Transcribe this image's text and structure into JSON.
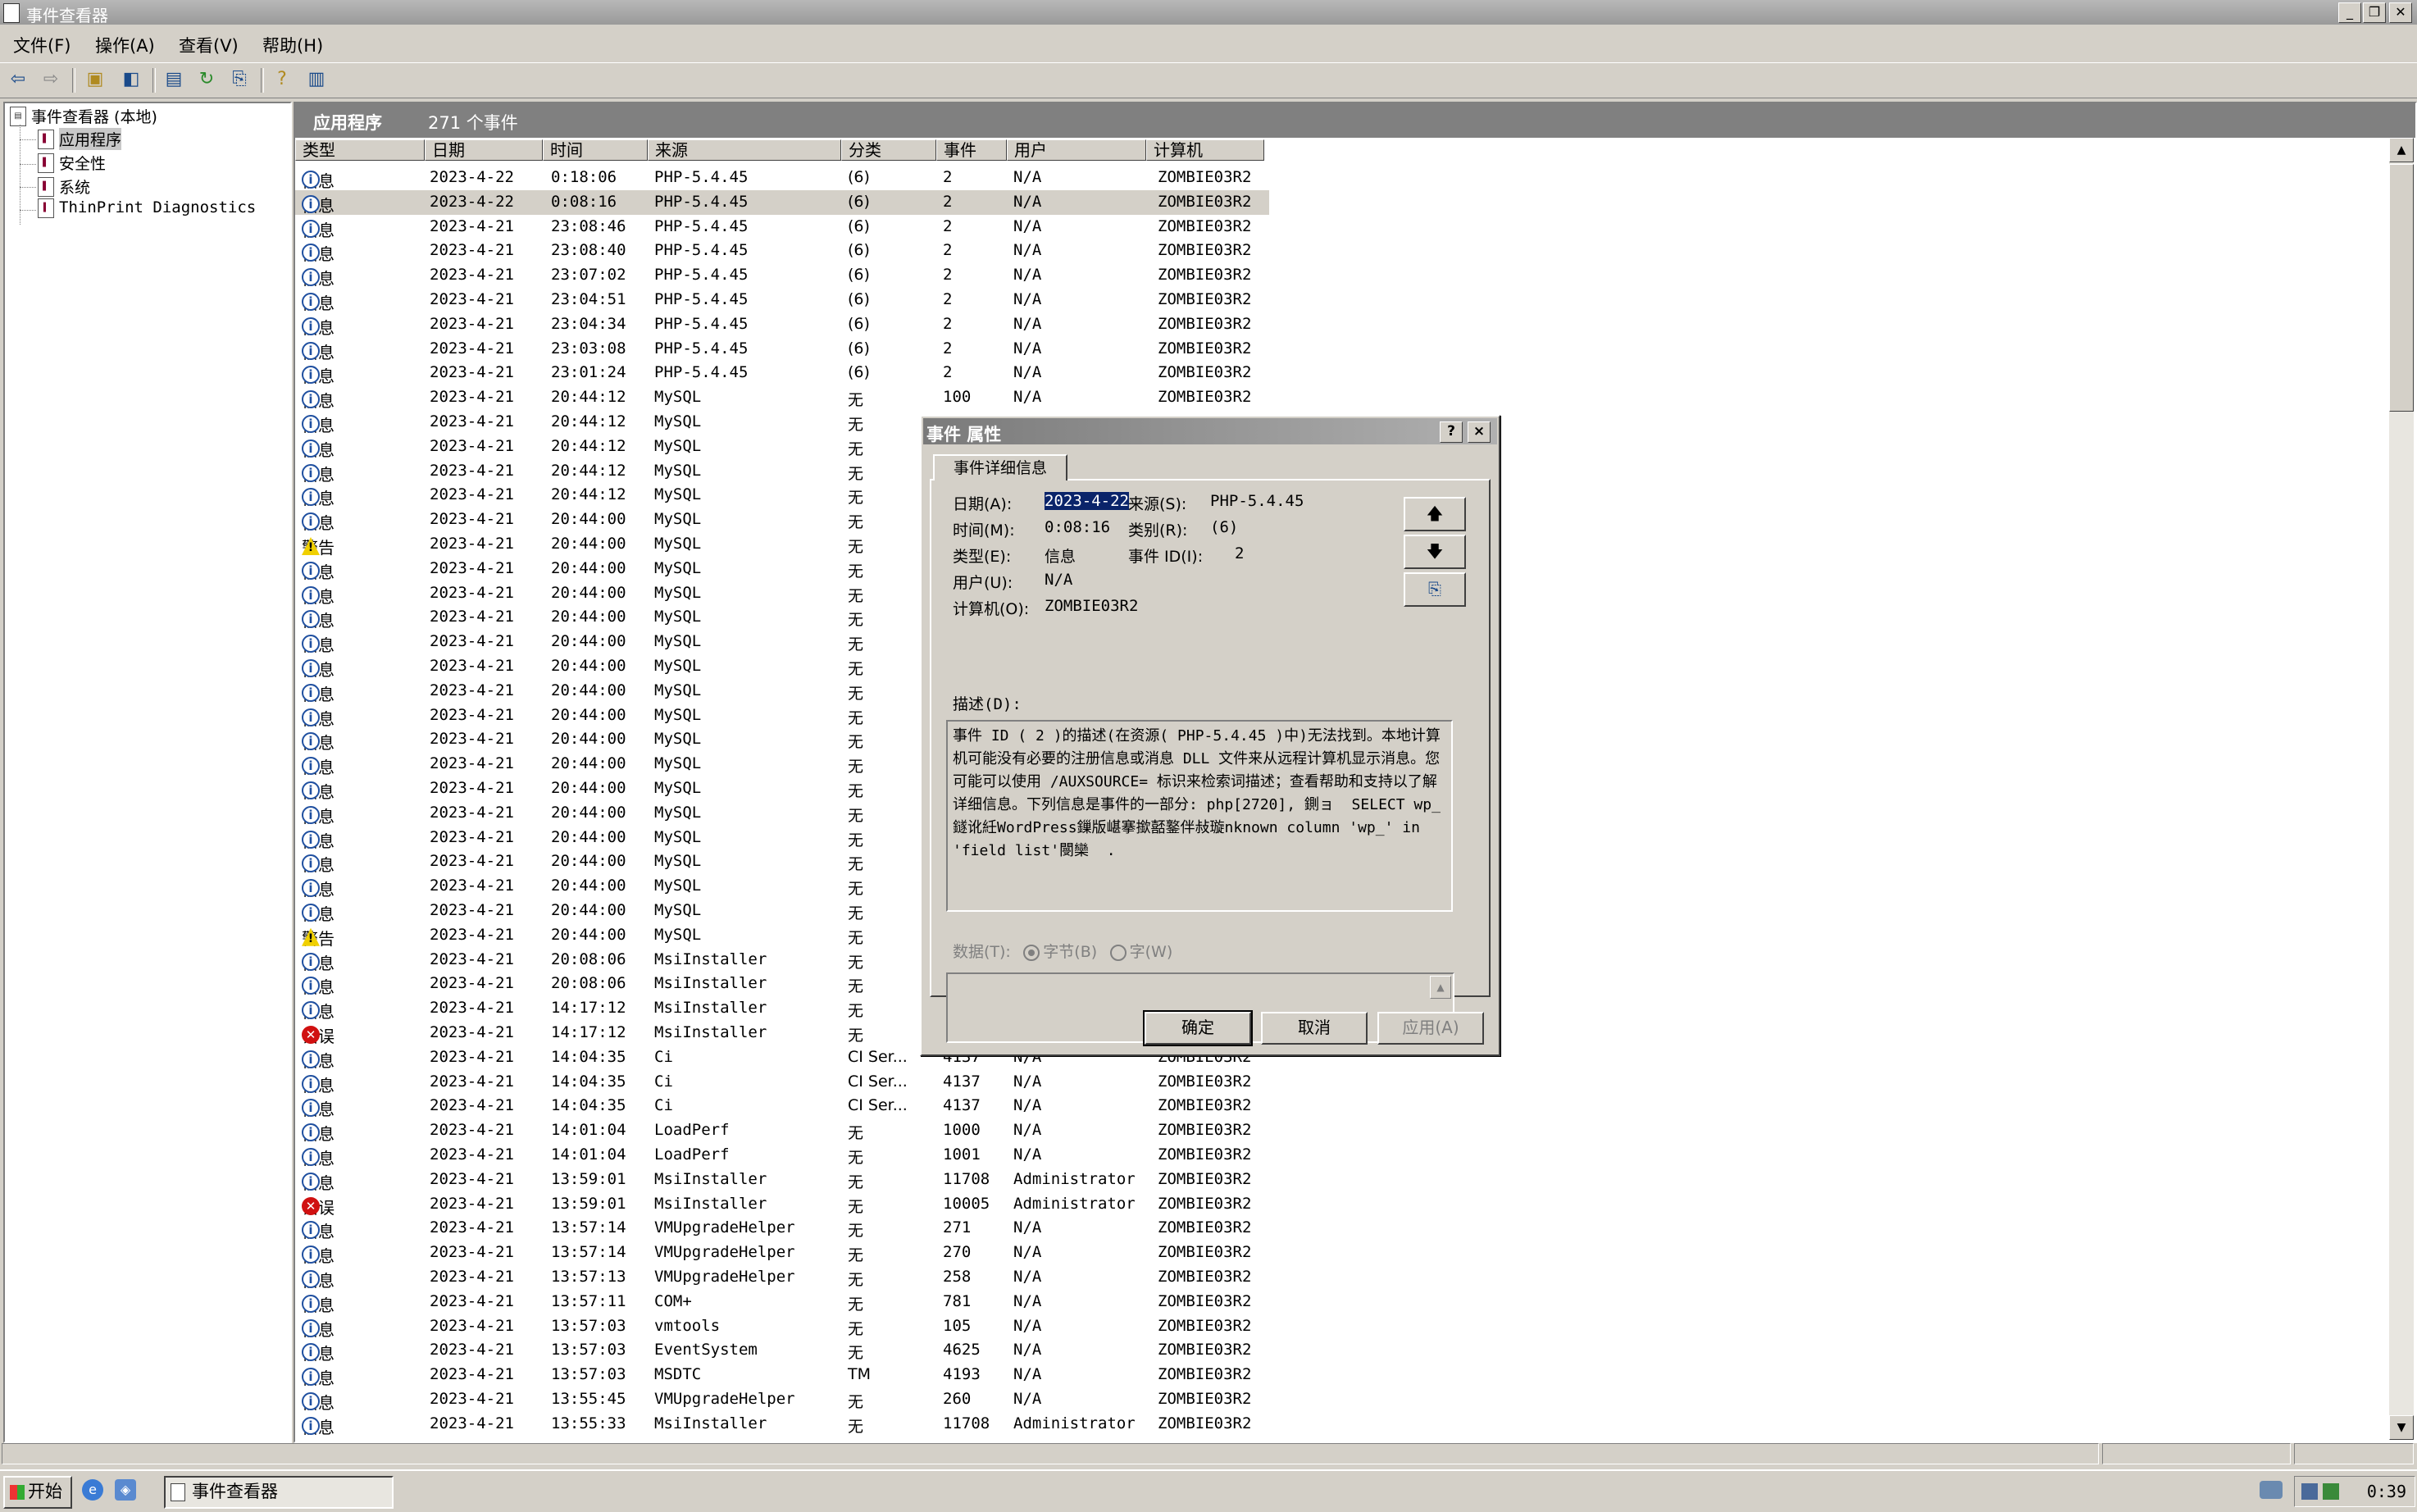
{
  "window": {
    "title": "事件查看器"
  },
  "menu": [
    "文件(F)",
    "操作(A)",
    "查看(V)",
    "帮助(H)"
  ],
  "tree": {
    "root": "事件查看器 (本地)",
    "items": [
      {
        "label": "应用程序",
        "selected": true
      },
      {
        "label": "安全性"
      },
      {
        "label": "系统"
      },
      {
        "label": "ThinPrint Diagnostics"
      }
    ]
  },
  "pane": {
    "title": "应用程序",
    "count": "271 个事件"
  },
  "columns": [
    "类型",
    "日期",
    "时间",
    "来源",
    "分类",
    "事件",
    "用户",
    "计算机"
  ],
  "rows": [
    {
      "type": "info",
      "tn": "信息",
      "d": "2023-4-22",
      "t": "0:18:06",
      "src": "PHP-5.4.45",
      "cat": "(6)",
      "ev": "2",
      "u": "N/A",
      "c": "ZOMBIE03R2"
    },
    {
      "type": "info",
      "tn": "信息",
      "d": "2023-4-22",
      "t": "0:08:16",
      "src": "PHP-5.4.45",
      "cat": "(6)",
      "ev": "2",
      "u": "N/A",
      "c": "ZOMBIE03R2",
      "sel": true
    },
    {
      "type": "info",
      "tn": "信息",
      "d": "2023-4-21",
      "t": "23:08:46",
      "src": "PHP-5.4.45",
      "cat": "(6)",
      "ev": "2",
      "u": "N/A",
      "c": "ZOMBIE03R2"
    },
    {
      "type": "info",
      "tn": "信息",
      "d": "2023-4-21",
      "t": "23:08:40",
      "src": "PHP-5.4.45",
      "cat": "(6)",
      "ev": "2",
      "u": "N/A",
      "c": "ZOMBIE03R2"
    },
    {
      "type": "info",
      "tn": "信息",
      "d": "2023-4-21",
      "t": "23:07:02",
      "src": "PHP-5.4.45",
      "cat": "(6)",
      "ev": "2",
      "u": "N/A",
      "c": "ZOMBIE03R2"
    },
    {
      "type": "info",
      "tn": "信息",
      "d": "2023-4-21",
      "t": "23:04:51",
      "src": "PHP-5.4.45",
      "cat": "(6)",
      "ev": "2",
      "u": "N/A",
      "c": "ZOMBIE03R2"
    },
    {
      "type": "info",
      "tn": "信息",
      "d": "2023-4-21",
      "t": "23:04:34",
      "src": "PHP-5.4.45",
      "cat": "(6)",
      "ev": "2",
      "u": "N/A",
      "c": "ZOMBIE03R2"
    },
    {
      "type": "info",
      "tn": "信息",
      "d": "2023-4-21",
      "t": "23:03:08",
      "src": "PHP-5.4.45",
      "cat": "(6)",
      "ev": "2",
      "u": "N/A",
      "c": "ZOMBIE03R2"
    },
    {
      "type": "info",
      "tn": "信息",
      "d": "2023-4-21",
      "t": "23:01:24",
      "src": "PHP-5.4.45",
      "cat": "(6)",
      "ev": "2",
      "u": "N/A",
      "c": "ZOMBIE03R2"
    },
    {
      "type": "info",
      "tn": "信息",
      "d": "2023-4-21",
      "t": "20:44:12",
      "src": "MySQL",
      "cat": "无",
      "ev": "100",
      "u": "N/A",
      "c": "ZOMBIE03R2"
    },
    {
      "type": "info",
      "tn": "信息",
      "d": "2023-4-21",
      "t": "20:44:12",
      "src": "MySQL",
      "cat": "无",
      "ev": "",
      "u": "",
      "c": ""
    },
    {
      "type": "info",
      "tn": "信息",
      "d": "2023-4-21",
      "t": "20:44:12",
      "src": "MySQL",
      "cat": "无",
      "ev": "",
      "u": "",
      "c": ""
    },
    {
      "type": "info",
      "tn": "信息",
      "d": "2023-4-21",
      "t": "20:44:12",
      "src": "MySQL",
      "cat": "无",
      "ev": "",
      "u": "",
      "c": ""
    },
    {
      "type": "info",
      "tn": "信息",
      "d": "2023-4-21",
      "t": "20:44:12",
      "src": "MySQL",
      "cat": "无",
      "ev": "",
      "u": "",
      "c": ""
    },
    {
      "type": "info",
      "tn": "信息",
      "d": "2023-4-21",
      "t": "20:44:00",
      "src": "MySQL",
      "cat": "无",
      "ev": "",
      "u": "",
      "c": ""
    },
    {
      "type": "warn",
      "tn": "警告",
      "d": "2023-4-21",
      "t": "20:44:00",
      "src": "MySQL",
      "cat": "无",
      "ev": "",
      "u": "",
      "c": ""
    },
    {
      "type": "info",
      "tn": "信息",
      "d": "2023-4-21",
      "t": "20:44:00",
      "src": "MySQL",
      "cat": "无",
      "ev": "",
      "u": "",
      "c": ""
    },
    {
      "type": "info",
      "tn": "信息",
      "d": "2023-4-21",
      "t": "20:44:00",
      "src": "MySQL",
      "cat": "无",
      "ev": "",
      "u": "",
      "c": ""
    },
    {
      "type": "info",
      "tn": "信息",
      "d": "2023-4-21",
      "t": "20:44:00",
      "src": "MySQL",
      "cat": "无",
      "ev": "",
      "u": "",
      "c": ""
    },
    {
      "type": "info",
      "tn": "信息",
      "d": "2023-4-21",
      "t": "20:44:00",
      "src": "MySQL",
      "cat": "无",
      "ev": "",
      "u": "",
      "c": ""
    },
    {
      "type": "info",
      "tn": "信息",
      "d": "2023-4-21",
      "t": "20:44:00",
      "src": "MySQL",
      "cat": "无",
      "ev": "",
      "u": "",
      "c": ""
    },
    {
      "type": "info",
      "tn": "信息",
      "d": "2023-4-21",
      "t": "20:44:00",
      "src": "MySQL",
      "cat": "无",
      "ev": "",
      "u": "",
      "c": ""
    },
    {
      "type": "info",
      "tn": "信息",
      "d": "2023-4-21",
      "t": "20:44:00",
      "src": "MySQL",
      "cat": "无",
      "ev": "",
      "u": "",
      "c": ""
    },
    {
      "type": "info",
      "tn": "信息",
      "d": "2023-4-21",
      "t": "20:44:00",
      "src": "MySQL",
      "cat": "无",
      "ev": "",
      "u": "",
      "c": ""
    },
    {
      "type": "info",
      "tn": "信息",
      "d": "2023-4-21",
      "t": "20:44:00",
      "src": "MySQL",
      "cat": "无",
      "ev": "",
      "u": "",
      "c": ""
    },
    {
      "type": "info",
      "tn": "信息",
      "d": "2023-4-21",
      "t": "20:44:00",
      "src": "MySQL",
      "cat": "无",
      "ev": "",
      "u": "",
      "c": ""
    },
    {
      "type": "info",
      "tn": "信息",
      "d": "2023-4-21",
      "t": "20:44:00",
      "src": "MySQL",
      "cat": "无",
      "ev": "",
      "u": "",
      "c": ""
    },
    {
      "type": "info",
      "tn": "信息",
      "d": "2023-4-21",
      "t": "20:44:00",
      "src": "MySQL",
      "cat": "无",
      "ev": "",
      "u": "",
      "c": ""
    },
    {
      "type": "info",
      "tn": "信息",
      "d": "2023-4-21",
      "t": "20:44:00",
      "src": "MySQL",
      "cat": "无",
      "ev": "",
      "u": "",
      "c": ""
    },
    {
      "type": "info",
      "tn": "信息",
      "d": "2023-4-21",
      "t": "20:44:00",
      "src": "MySQL",
      "cat": "无",
      "ev": "",
      "u": "",
      "c": ""
    },
    {
      "type": "info",
      "tn": "信息",
      "d": "2023-4-21",
      "t": "20:44:00",
      "src": "MySQL",
      "cat": "无",
      "ev": "",
      "u": "",
      "c": ""
    },
    {
      "type": "warn",
      "tn": "警告",
      "d": "2023-4-21",
      "t": "20:44:00",
      "src": "MySQL",
      "cat": "无",
      "ev": "",
      "u": "",
      "c": ""
    },
    {
      "type": "info",
      "tn": "信息",
      "d": "2023-4-21",
      "t": "20:08:06",
      "src": "MsiInstaller",
      "cat": "无",
      "ev": "",
      "u": "",
      "c": ""
    },
    {
      "type": "info",
      "tn": "信息",
      "d": "2023-4-21",
      "t": "20:08:06",
      "src": "MsiInstaller",
      "cat": "无",
      "ev": "",
      "u": "",
      "c": ""
    },
    {
      "type": "info",
      "tn": "信息",
      "d": "2023-4-21",
      "t": "14:17:12",
      "src": "MsiInstaller",
      "cat": "无",
      "ev": "",
      "u": "",
      "c": ""
    },
    {
      "type": "err",
      "tn": "错误",
      "d": "2023-4-21",
      "t": "14:17:12",
      "src": "MsiInstaller",
      "cat": "无",
      "ev": "",
      "u": "",
      "c": ""
    },
    {
      "type": "info",
      "tn": "信息",
      "d": "2023-4-21",
      "t": "14:04:35",
      "src": "Ci",
      "cat": "CI Ser...",
      "ev": "4137",
      "u": "N/A",
      "c": "ZOMBIE03R2"
    },
    {
      "type": "info",
      "tn": "信息",
      "d": "2023-4-21",
      "t": "14:04:35",
      "src": "Ci",
      "cat": "CI Ser...",
      "ev": "4137",
      "u": "N/A",
      "c": "ZOMBIE03R2"
    },
    {
      "type": "info",
      "tn": "信息",
      "d": "2023-4-21",
      "t": "14:04:35",
      "src": "Ci",
      "cat": "CI Ser...",
      "ev": "4137",
      "u": "N/A",
      "c": "ZOMBIE03R2"
    },
    {
      "type": "info",
      "tn": "信息",
      "d": "2023-4-21",
      "t": "14:01:04",
      "src": "LoadPerf",
      "cat": "无",
      "ev": "1000",
      "u": "N/A",
      "c": "ZOMBIE03R2"
    },
    {
      "type": "info",
      "tn": "信息",
      "d": "2023-4-21",
      "t": "14:01:04",
      "src": "LoadPerf",
      "cat": "无",
      "ev": "1001",
      "u": "N/A",
      "c": "ZOMBIE03R2"
    },
    {
      "type": "info",
      "tn": "信息",
      "d": "2023-4-21",
      "t": "13:59:01",
      "src": "MsiInstaller",
      "cat": "无",
      "ev": "11708",
      "u": "Administrator",
      "c": "ZOMBIE03R2"
    },
    {
      "type": "err",
      "tn": "错误",
      "d": "2023-4-21",
      "t": "13:59:01",
      "src": "MsiInstaller",
      "cat": "无",
      "ev": "10005",
      "u": "Administrator",
      "c": "ZOMBIE03R2"
    },
    {
      "type": "info",
      "tn": "信息",
      "d": "2023-4-21",
      "t": "13:57:14",
      "src": "VMUpgradeHelper",
      "cat": "无",
      "ev": "271",
      "u": "N/A",
      "c": "ZOMBIE03R2"
    },
    {
      "type": "info",
      "tn": "信息",
      "d": "2023-4-21",
      "t": "13:57:14",
      "src": "VMUpgradeHelper",
      "cat": "无",
      "ev": "270",
      "u": "N/A",
      "c": "ZOMBIE03R2"
    },
    {
      "type": "info",
      "tn": "信息",
      "d": "2023-4-21",
      "t": "13:57:13",
      "src": "VMUpgradeHelper",
      "cat": "无",
      "ev": "258",
      "u": "N/A",
      "c": "ZOMBIE03R2"
    },
    {
      "type": "info",
      "tn": "信息",
      "d": "2023-4-21",
      "t": "13:57:11",
      "src": "COM+",
      "cat": "无",
      "ev": "781",
      "u": "N/A",
      "c": "ZOMBIE03R2"
    },
    {
      "type": "info",
      "tn": "信息",
      "d": "2023-4-21",
      "t": "13:57:03",
      "src": "vmtools",
      "cat": "无",
      "ev": "105",
      "u": "N/A",
      "c": "ZOMBIE03R2"
    },
    {
      "type": "info",
      "tn": "信息",
      "d": "2023-4-21",
      "t": "13:57:03",
      "src": "EventSystem",
      "cat": "无",
      "ev": "4625",
      "u": "N/A",
      "c": "ZOMBIE03R2"
    },
    {
      "type": "info",
      "tn": "信息",
      "d": "2023-4-21",
      "t": "13:57:03",
      "src": "MSDTC",
      "cat": "TM",
      "ev": "4193",
      "u": "N/A",
      "c": "ZOMBIE03R2"
    },
    {
      "type": "info",
      "tn": "信息",
      "d": "2023-4-21",
      "t": "13:55:45",
      "src": "VMUpgradeHelper",
      "cat": "无",
      "ev": "260",
      "u": "N/A",
      "c": "ZOMBIE03R2"
    },
    {
      "type": "info",
      "tn": "信息",
      "d": "2023-4-21",
      "t": "13:55:33",
      "src": "MsiInstaller",
      "cat": "无",
      "ev": "11708",
      "u": "Administrator",
      "c": "ZOMBIE03R2"
    }
  ],
  "dialog": {
    "title": "事件 属性",
    "help_btn": "?",
    "close_btn": "×",
    "tab": "事件详细信息",
    "date_label": "日期(A):",
    "date_value": "2023-4-22",
    "source_label": "来源(S):",
    "source_value": "PHP-5.4.45",
    "time_label": "时间(M):",
    "time_value": "0:08:16",
    "category_label": "类别(R):",
    "category_value": "(6)",
    "type_label": "类型(E):",
    "type_value": "信息",
    "eventid_label": "事件 ID(I):",
    "eventid_value": "2",
    "user_label": "用户(U):",
    "user_value": "N/A",
    "computer_label": "计算机(O):",
    "computer_value": "ZOMBIE03R2",
    "desc_label": "描述(D):",
    "description": "事件 ID ( 2 )的描述(在资源( PHP-5.4.45 )中)无法找到。本地计算机可能没有必要的注册信息或消息 DLL 文件来从远程计算机显示消息。您可能可以使用 /AUXSOURCE= 标识来检索词描述；查看帮助和支持以了解详细信息。下列信息是事件的一部分: php[2720], 鍘ョ  SELECT wp_鐩讹紝WordPress鏁版嵁搴撳嚭鐜伴敊璇nknown column 'wp_' in 'field list'閿欒  .",
    "data_label": "数据(T):",
    "radio_bytes": "字节(B)",
    "radio_words": "字(W)",
    "ok": "确定",
    "cancel": "取消",
    "apply": "应用(A)"
  },
  "taskbar": {
    "start": "开始",
    "task": "事件查看器",
    "clock": "0:39"
  }
}
